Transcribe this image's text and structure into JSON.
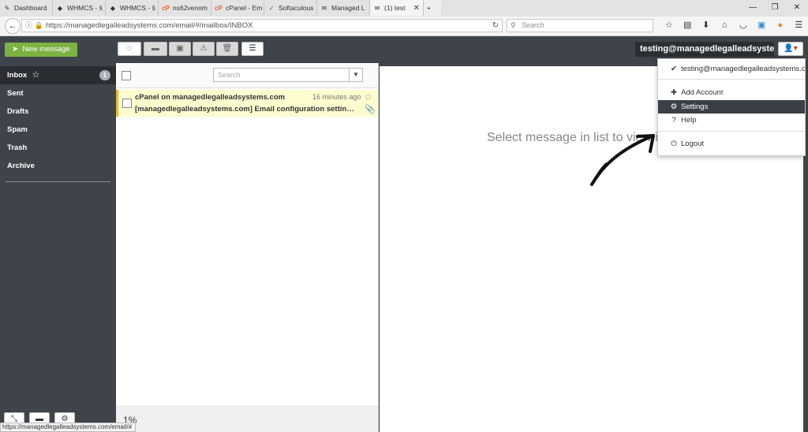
{
  "browser": {
    "tabs": [
      {
        "label": "Dashboard",
        "icon": "✎"
      },
      {
        "label": "WHMCS - š",
        "icon": "◆"
      },
      {
        "label": "WHMCS - š",
        "icon": "◆"
      },
      {
        "label": "ns62venom",
        "icon": "cP"
      },
      {
        "label": "cPanel - Em",
        "icon": "cP"
      },
      {
        "label": "Softaculous",
        "icon": "✓"
      },
      {
        "label": "Managed L",
        "icon": "✉"
      },
      {
        "label": "(1) test",
        "icon": "✉"
      }
    ],
    "url": "https://managedlegalleadsystems.com/email/#/mailbox/INBOX",
    "search_placeholder": "Search",
    "status_url": "https://managedlegalleadsystems.com/email/#"
  },
  "toolbar": {
    "new_message": "New message",
    "account_email": "testing@managedlegalleadsystems.com"
  },
  "folders": [
    {
      "label": "Inbox",
      "count": "1"
    },
    {
      "label": "Sent"
    },
    {
      "label": "Drafts"
    },
    {
      "label": "Spam"
    },
    {
      "label": "Trash"
    },
    {
      "label": "Archive"
    }
  ],
  "message_list": {
    "search_placeholder": "Search",
    "messages": [
      {
        "from": "cPanel on managedlegalleadsystems.com",
        "time": "16 minutes ago",
        "subject": "[managedlegalleadsystems.com] Email configuration settings for “testing@managedlegalleadsystems.com”"
      }
    ],
    "quota": "1%"
  },
  "viewer": {
    "placeholder": "Select message in list to view it"
  },
  "account_menu": {
    "current": "testing@managedlegalleadsystems.com",
    "add_account": "Add Account",
    "settings": "Settings",
    "help": "Help",
    "logout": "Logout"
  },
  "colors": {
    "accent_green": "#7cb342",
    "sidebar_bg": "#3f444b",
    "unread_highlight": "#fdfdd0",
    "menu_highlight": "#3b4047"
  }
}
